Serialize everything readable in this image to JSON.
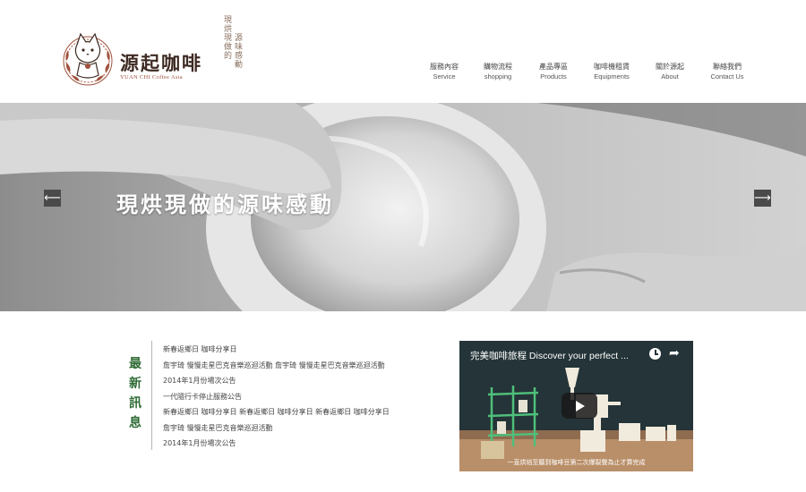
{
  "header": {
    "brand_name": "源起咖啡",
    "brand_sub": "YUAN CHI Coffee Asia",
    "slogan_line1": "現烘現做的",
    "slogan_line2": "源味感動"
  },
  "nav": {
    "items": [
      {
        "zh": "服務內容",
        "en": "Service"
      },
      {
        "zh": "購物流程",
        "en": "shopping"
      },
      {
        "zh": "產品專區",
        "en": "Products"
      },
      {
        "zh": "咖啡機租賃",
        "en": "Equipments"
      },
      {
        "zh": "關於源起",
        "en": "About"
      },
      {
        "zh": "聯絡我們",
        "en": "Contact Us"
      }
    ]
  },
  "hero": {
    "title": "現烘現做的源味感動",
    "prev_label": "⟵",
    "next_label": "⟶"
  },
  "news": {
    "heading": [
      "最",
      "新",
      "訊",
      "息"
    ],
    "items": [
      "新春返鄉日 咖啡分享日",
      "詹宇琦 慢慢走星巴克音樂巡迴活動 詹宇琦 慢慢走星巴克音樂巡迴活動",
      "2014年1月份場次公告",
      "一代隨行卡停止服務公告",
      "新春返鄉日 咖啡分享日 新春返鄉日 咖啡分享日 新春返鄉日 咖啡分享日",
      "詹宇琦 慢慢走星巴克音樂巡迴活動",
      "2014年1月份場次公告"
    ]
  },
  "video": {
    "title": "完美咖啡旅程 Discover your perfect ...",
    "share_glyph": "➦",
    "caption": "一直烘焙至聽到咖啡豆第二次爆裂聲為止才算完成"
  },
  "colors": {
    "accent_green": "#2f6b35",
    "brand_brown": "#3d2a22",
    "brand_red": "#a0523d"
  }
}
